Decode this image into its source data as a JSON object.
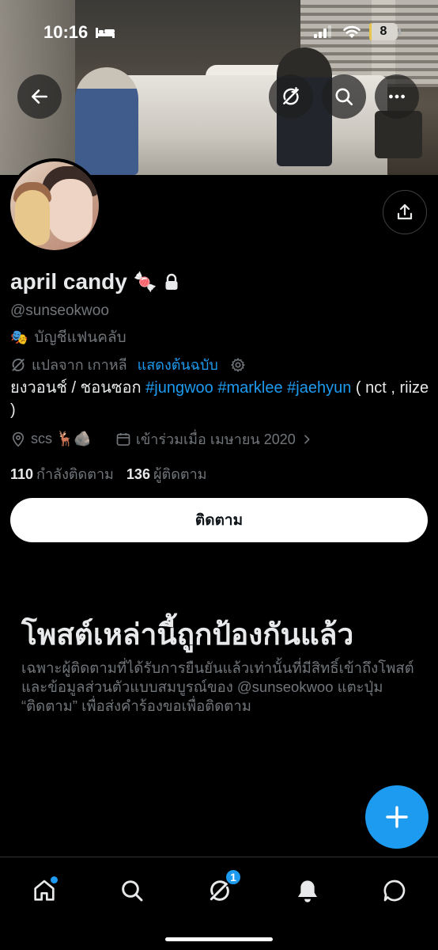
{
  "status_bar": {
    "time": "10:16",
    "battery": "8",
    "battery_level": 0.08
  },
  "profile": {
    "name": "april candy",
    "name_emoji": "🍬",
    "handle": "@sunseokwoo",
    "fanclub_label": "บัญชีแฟนคลับ",
    "fanclub_emoji": "🎭",
    "translate": {
      "label": "แปลจาก เกาหลี",
      "show_original": "แสดงต้นฉบับ"
    },
    "bio": {
      "text1": "ยงวอนช์ / ชอนซอก ",
      "tags": [
        "#jungwoo",
        "#marklee",
        "#jaehyun"
      ],
      "text2": " ( nct , riize )"
    },
    "location": "scs 🦌🪨",
    "joined": "เข้าร่วมเมื่อ เมษายน 2020",
    "following_count": "110",
    "following_label": "กำลังติดตาม",
    "followers_count": "136",
    "followers_label": "ผู้ติดตาม",
    "follow_button": "ติดตาม"
  },
  "protected": {
    "title": "โพสต์เหล่านี้ถูกป้องกันแล้ว",
    "description": "เฉพาะผู้ติดตามที่ได้รับการยืนยันแล้วเท่านั้นที่มีสิทธิ์เข้าถึงโพสต์และข้อมูลส่วนตัวแบบสมบูรณ์ของ @sunseokwoo แตะปุ่ม “ติดตาม” เพื่อส่งคำร้องขอเพื่อติดตาม"
  },
  "nav": {
    "messages_badge": "1"
  },
  "colors": {
    "accent": "#1d9bf0",
    "background": "#000000",
    "muted": "#71767b",
    "text": "#e7e9ea"
  },
  "icons": [
    "back-arrow-icon",
    "translate-icon",
    "search-icon",
    "more-icon",
    "share-icon",
    "lock-icon",
    "location-icon",
    "calendar-icon",
    "chevron-right-icon",
    "plus-icon",
    "home-icon",
    "explore-icon",
    "grok-icon",
    "notifications-icon",
    "messages-icon"
  ]
}
